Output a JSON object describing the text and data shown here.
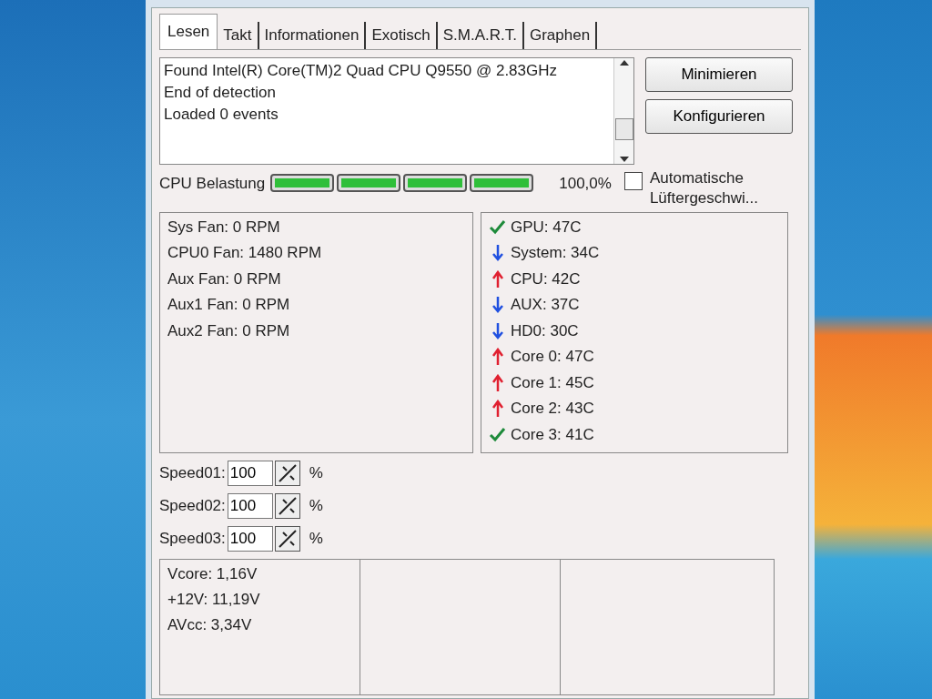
{
  "tabs": [
    {
      "label": "Lesen",
      "selected": true
    },
    {
      "label": "Takt",
      "selected": false
    },
    {
      "label": "Informationen",
      "selected": false
    },
    {
      "label": "Exotisch",
      "selected": false
    },
    {
      "label": "S.M.A.R.T.",
      "selected": false
    },
    {
      "label": "Graphen",
      "selected": false
    }
  ],
  "log": [
    "Found Intel(R) Core(TM)2 Quad CPU Q9550 @ 2.83GHz",
    "End of detection",
    "Loaded 0 events"
  ],
  "buttons": [
    "Minimieren",
    "Konfigurieren"
  ],
  "cpu_load": {
    "label": "CPU Belastung",
    "cores": [
      {
        "level": 1
      },
      {
        "level": 1
      },
      {
        "level": 1
      },
      {
        "level": 1
      }
    ],
    "reading": "100,0%"
  },
  "auto_fan": {
    "lines": [
      "Automatische",
      "Lüftergeschwi..."
    ],
    "checked": false
  },
  "fans": [
    {
      "label": "Sys Fan:",
      "value": "0 RPM"
    },
    {
      "label": "CPU0 Fan:",
      "value": "1480 RPM"
    },
    {
      "label": "Aux Fan:",
      "value": "0 RPM"
    },
    {
      "label": "Aux1 Fan:",
      "value": "0 RPM"
    },
    {
      "label": "Aux2 Fan:",
      "value": "0 RPM"
    }
  ],
  "temps": [
    {
      "kind": "ok",
      "label": "GPU:",
      "value": "47C"
    },
    {
      "kind": "down",
      "label": "System:",
      "value": "34C"
    },
    {
      "kind": "up",
      "label": "CPU:",
      "value": "42C"
    },
    {
      "kind": "down",
      "label": "AUX:",
      "value": "37C"
    },
    {
      "kind": "down",
      "label": "HD0:",
      "value": "30C"
    },
    {
      "kind": "up",
      "label": "Core 0:",
      "value": "47C"
    },
    {
      "kind": "up",
      "label": "Core 1:",
      "value": "45C"
    },
    {
      "kind": "up",
      "label": "Core 2:",
      "value": "43C"
    },
    {
      "kind": "ok",
      "label": "Core 3:",
      "value": "41C"
    }
  ],
  "speeds": [
    {
      "label": "Speed01:",
      "value": "100",
      "unit": "%"
    },
    {
      "label": "Speed02:",
      "value": "100",
      "unit": "%"
    },
    {
      "label": "Speed03:",
      "value": "100",
      "unit": "%"
    }
  ],
  "voltages": [
    {
      "label": "Vcore:",
      "value": "1,16V"
    },
    {
      "label": "+12V:",
      "value": "11,19V"
    },
    {
      "label": "AVcc:",
      "value": "3,34V"
    }
  ]
}
